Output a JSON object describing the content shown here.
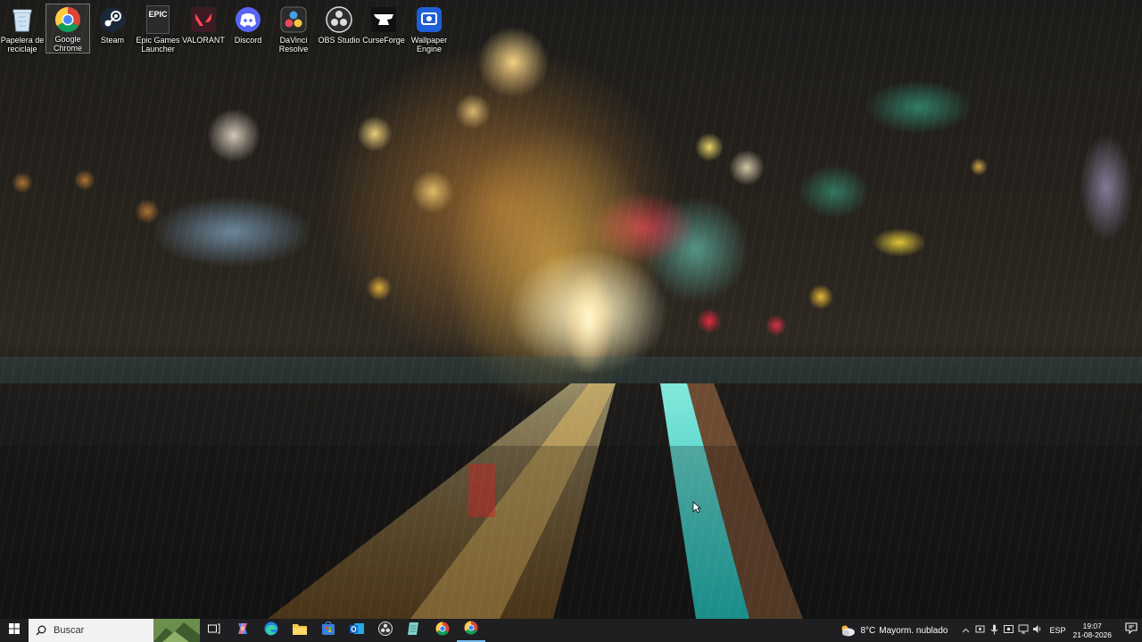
{
  "desktop": {
    "icons": [
      {
        "label": "Papelera de reciclaje",
        "icon": "recycle-bin-icon"
      },
      {
        "label": "Google Chrome",
        "icon": "chrome-icon",
        "selected": true
      },
      {
        "label": "Steam",
        "icon": "steam-icon"
      },
      {
        "label": "Epic Games Launcher",
        "icon": "epic-games-icon",
        "logo_text": "EPIC"
      },
      {
        "label": "VALORANT",
        "icon": "valorant-icon"
      },
      {
        "label": "Discord",
        "icon": "discord-icon"
      },
      {
        "label": "DaVinci Resolve",
        "icon": "davinci-resolve-icon"
      },
      {
        "label": "OBS Studio",
        "icon": "obs-studio-icon"
      },
      {
        "label": "CurseForge",
        "icon": "curseforge-icon"
      },
      {
        "label": "Wallpaper Engine",
        "icon": "wallpaper-engine-icon"
      }
    ]
  },
  "taskbar": {
    "start_icon": "windows-start-icon",
    "search": {
      "placeholder": "Buscar"
    },
    "pinned": [
      "task-view-icon",
      "copilot-icon",
      "edge-icon",
      "file-explorer-icon",
      "microsoft-store-icon",
      "outlook-icon",
      "obs-studio-icon",
      "notepad-icon",
      "chrome-icon",
      "chrome-icon"
    ],
    "weather": {
      "temp": "8°C",
      "condition": "Mayorm. nublado"
    },
    "language": "ESP",
    "time": "19:07",
    "date": "21-08-2026"
  }
}
